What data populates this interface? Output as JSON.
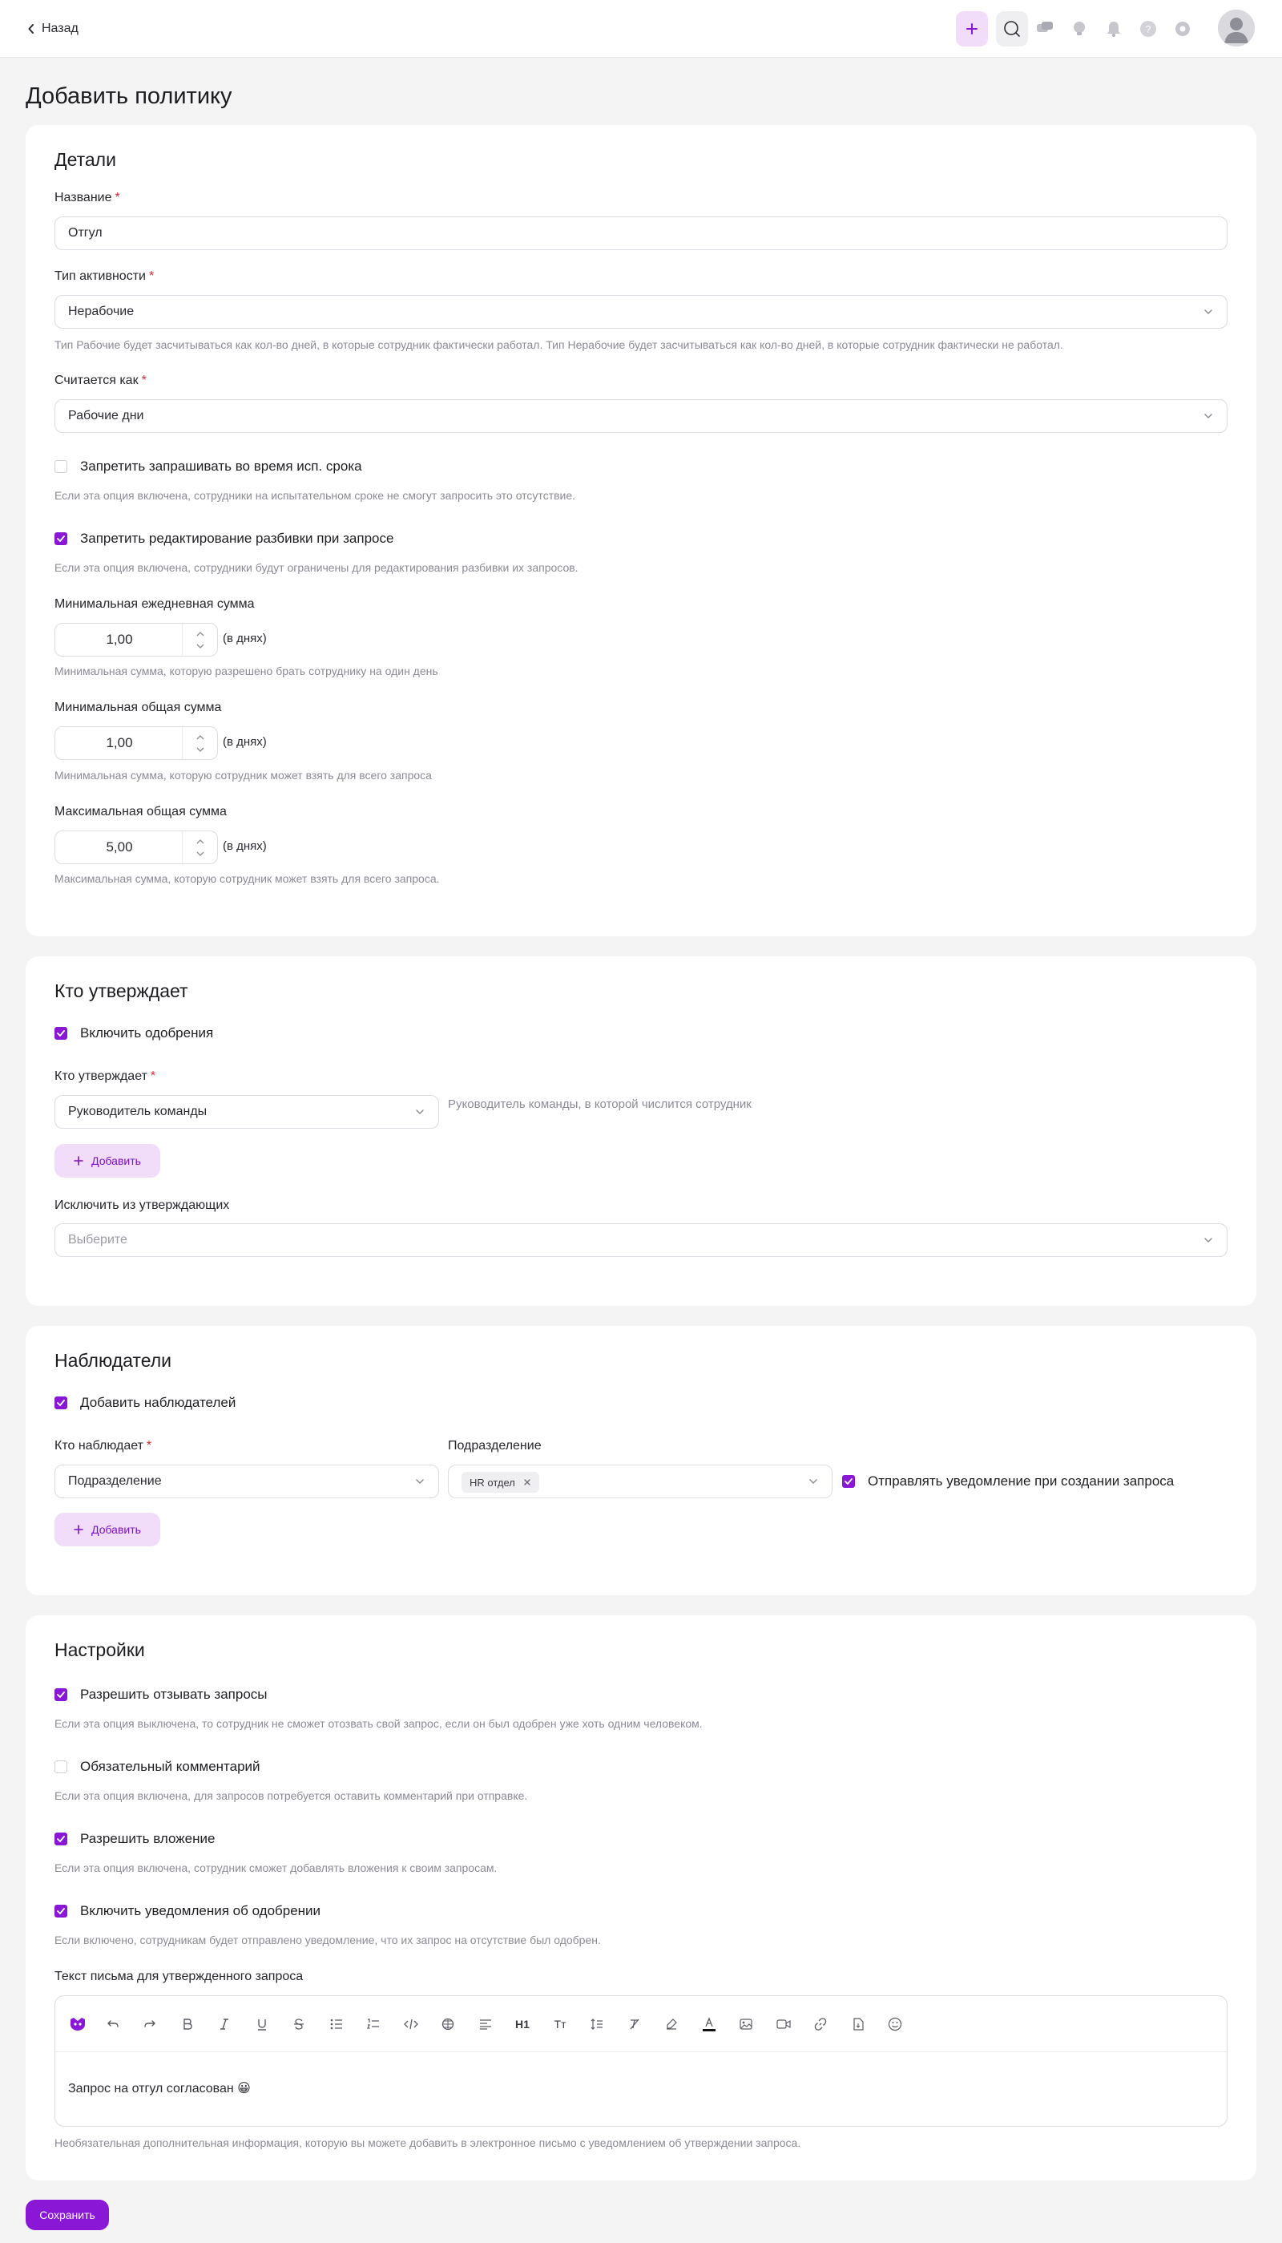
{
  "header": {
    "back_label": "Назад"
  },
  "page": {
    "title": "Добавить политику",
    "save_label": "Сохранить"
  },
  "details": {
    "title": "Детали",
    "name_label": "Название",
    "name_value": "Отгул",
    "activity_label": "Тип активности",
    "activity_value": "Нерабочие",
    "activity_hint": "Тип Рабочие будет засчитываться как кол-во дней, в которые сотрудник фактически работал. Тип Нерабочие будет засчитываться как кол-во дней, в которые сотрудник фактически не работал.",
    "counted_label": "Считается как",
    "counted_value": "Рабочие дни",
    "probation_label": "Запретить запрашивать во время исп. срока",
    "probation_checked": false,
    "probation_hint": "Если эта опция включена, сотрудники на испытательном сроке не смогут запросить это отсутствие.",
    "split_label": "Запретить редактирование разбивки при запросе",
    "split_checked": true,
    "split_hint": "Если эта опция включена, сотрудники будут ограничены для редактирования разбивки их запросов.",
    "min_daily_label": "Минимальная ежедневная сумма",
    "min_daily_value": "1,00",
    "min_daily_hint": "Минимальная сумма, которую разрешено брать сотруднику на один день",
    "min_total_label": "Минимальная общая сумма",
    "min_total_value": "1,00",
    "min_total_hint": "Минимальная сумма, которую сотрудник может взять для всего запроса",
    "max_total_label": "Максимальная общая сумма",
    "max_total_value": "5,00",
    "max_total_hint": "Максимальная сумма, которую сотрудник может взять для всего запроса.",
    "unit": "(в днях)"
  },
  "approvers": {
    "title": "Кто утверждает",
    "enable_label": "Включить одобрения",
    "enable_checked": true,
    "who_label": "Кто утверждает",
    "who_value": "Руководитель команды",
    "who_hint": "Руководитель команды, в которой числится сотрудник",
    "add_label": "Добавить",
    "exclude_label": "Исключить из утверждающих",
    "exclude_placeholder": "Выберите"
  },
  "observers": {
    "title": "Наблюдатели",
    "add_observers_label": "Добавить наблюдателей",
    "add_observers_checked": true,
    "who_label": "Кто наблюдает",
    "who_value": "Подразделение",
    "dept_label": "Подразделение",
    "dept_tag": "HR отдел",
    "notify_label": "Отправлять уведомление при создании запроса",
    "notify_checked": true,
    "add_label": "Добавить"
  },
  "settings": {
    "title": "Настройки",
    "revoke_label": "Разрешить отзывать запросы",
    "revoke_checked": true,
    "revoke_hint": "Если эта опция выключена, то сотрудник не сможет отозвать свой запрос, если он был одобрен уже хоть одним человеком.",
    "comment_label": "Обязательный комментарий",
    "comment_checked": false,
    "comment_hint": "Если эта опция включена, для запросов потребуется оставить комментарий при отправке.",
    "attach_label": "Разрешить вложение",
    "attach_checked": true,
    "attach_hint": "Если эта опция включена, сотрудник сможет добавлять вложения к своим запросам.",
    "notif_label": "Включить уведомления об одобрении",
    "notif_checked": true,
    "notif_hint": "Если включено, сотрудникам будет отправлено уведомление, что их запрос на отсутствие был одобрен.",
    "email_label": "Текст письма для утвержденного запроса",
    "email_text": "Запрос на отгул согласован 😀",
    "email_hint": "Необязательная дополнительная информация, которую вы можете добавить в электронное письмо с уведомлением об утверждении запроса.",
    "toolbar_h1": "H1",
    "toolbar_text_size": "Tт"
  },
  "colors": {
    "accent": "#8a16d6",
    "accent_light": "#f1dcfa",
    "required": "#e0272e"
  }
}
